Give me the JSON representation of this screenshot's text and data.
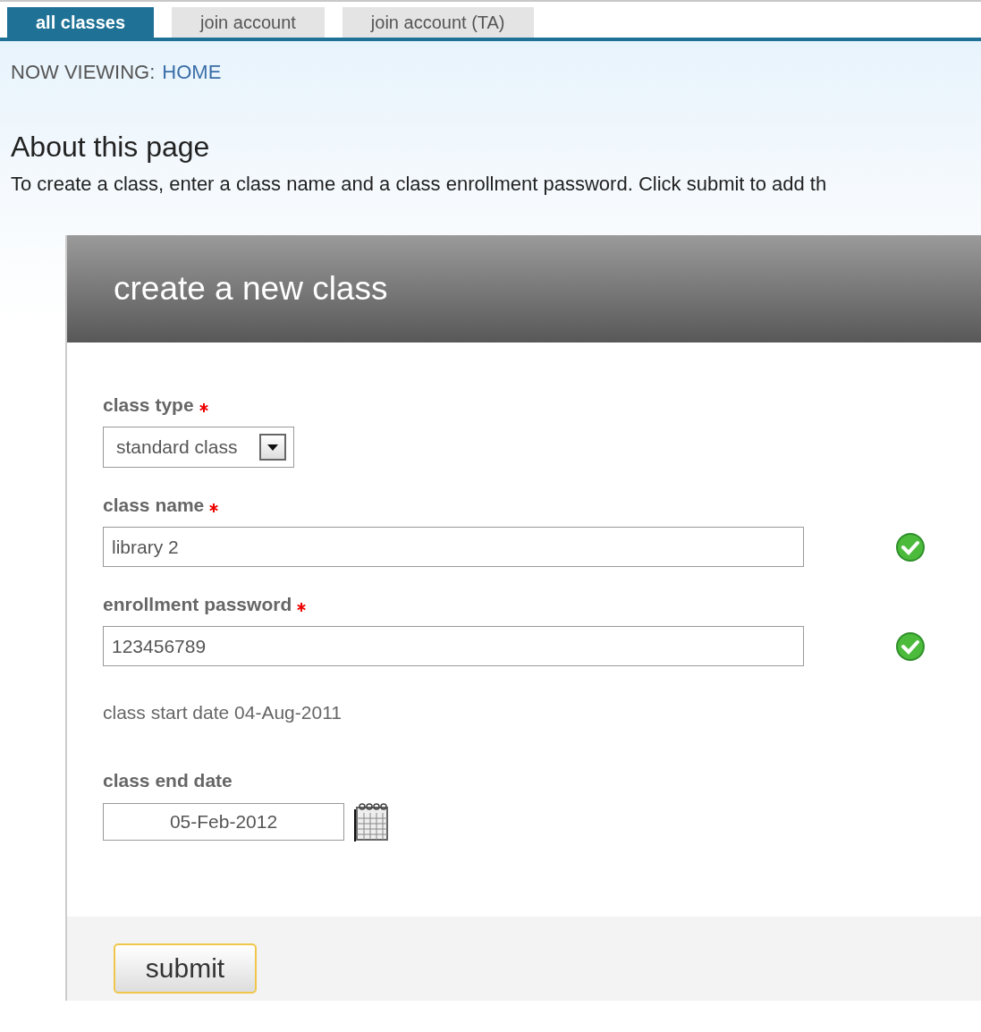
{
  "tabs": [
    {
      "label": "all classes",
      "selected": true
    },
    {
      "label": "join account",
      "selected": false
    },
    {
      "label": "join account (TA)",
      "selected": false
    }
  ],
  "breadcrumb": {
    "label": "NOW VIEWING:",
    "link": "HOME"
  },
  "about": {
    "heading": "About this page",
    "text": "To create a class, enter a class name and a class enrollment password. Click submit to add th"
  },
  "form": {
    "title": "create a new class",
    "fields": [
      {
        "kind": "select",
        "label": "class type",
        "required": true,
        "value": "standard class"
      },
      {
        "kind": "text",
        "label": "class name",
        "required": true,
        "value": "library 2",
        "valid": true
      },
      {
        "kind": "text",
        "label": "enrollment password",
        "required": true,
        "value": "123456789",
        "valid": true
      },
      {
        "kind": "static",
        "text": "class start date 04-Aug-2011"
      },
      {
        "kind": "date",
        "label": "class end date",
        "value": "05-Feb-2012"
      }
    ],
    "submit": "submit"
  }
}
